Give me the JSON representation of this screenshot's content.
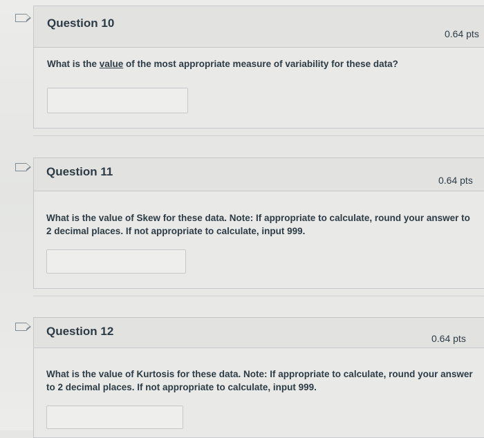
{
  "questions": [
    {
      "title": "Question 10",
      "points": "0.64 pts",
      "text_before": "What is the ",
      "text_underlined": "value",
      "text_after": " of the most appropriate measure of variability for these data?",
      "answer_value": ""
    },
    {
      "title": "Question 11",
      "points": "0.64 pts",
      "text_line1": "What is the value of Skew for these data.  Note: If appropriate to calculate, round your answer to",
      "text_line2": "2 decimal places.  If not appropriate to calculate, input 999.",
      "answer_value": ""
    },
    {
      "title": "Question 12",
      "points": "0.64 pts",
      "text_line1": "What is the value of Kurtosis for these data.  Note: If appropriate to calculate, round your answer",
      "text_line2": "to 2 decimal places.  If not appropriate to calculate, input 999.",
      "answer_value": ""
    }
  ]
}
